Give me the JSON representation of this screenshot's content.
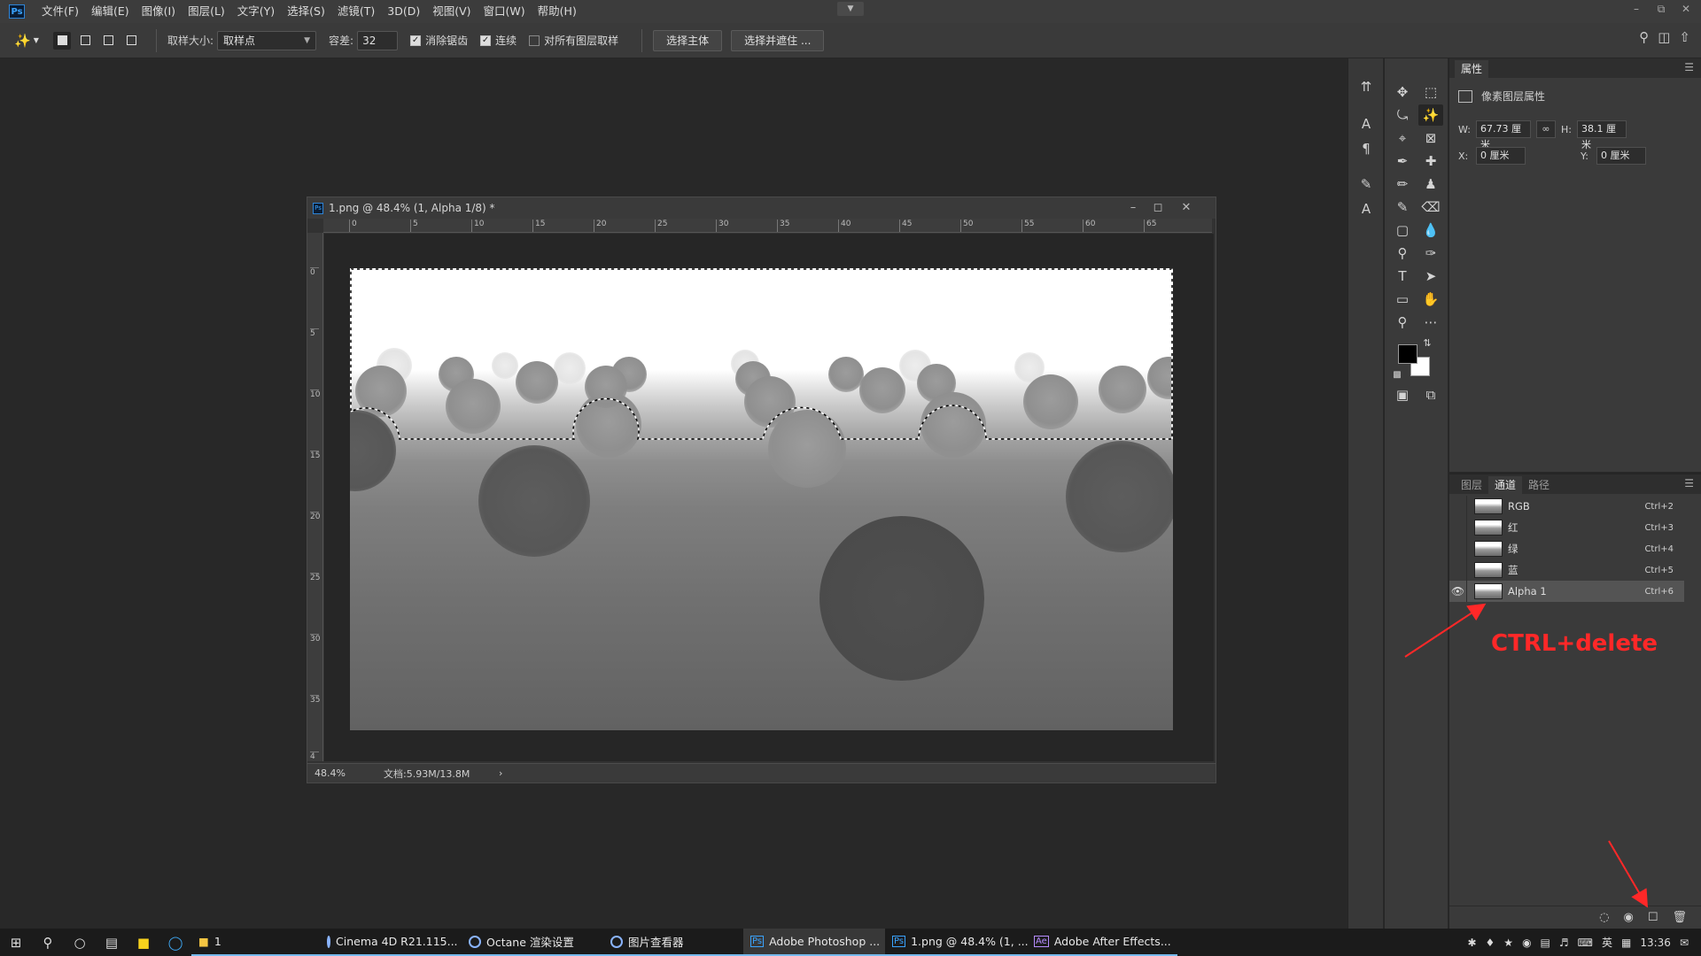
{
  "menubar": {
    "logo": "Ps",
    "items": [
      "文件(F)",
      "编辑(E)",
      "图像(I)",
      "图层(L)",
      "文字(Y)",
      "选择(S)",
      "滤镜(T)",
      "3D(D)",
      "视图(V)",
      "窗口(W)",
      "帮助(H)"
    ]
  },
  "options": {
    "sample_size_label": "取样大小:",
    "sample_size_value": "取样点",
    "tolerance_label": "容差:",
    "tolerance_value": "32",
    "antialias_label": "消除锯齿",
    "contiguous_label": "连续",
    "sample_all_label": "对所有图层取样",
    "select_subject": "选择主体",
    "select_mask": "选择并遮住 ..."
  },
  "document": {
    "title": "1.png @ 48.4% (1, Alpha 1/8) *",
    "zoom": "48.4%",
    "doc_info": "文档:5.93M/13.8M",
    "status_arrow": "›",
    "ruler_top": [
      "0",
      "5",
      "10",
      "15",
      "20",
      "25",
      "30",
      "35",
      "40",
      "45",
      "50",
      "55",
      "60",
      "65"
    ],
    "ruler_left": [
      "0",
      "5",
      "10",
      "15",
      "20",
      "25",
      "30",
      "35",
      "4"
    ]
  },
  "properties": {
    "tab": "属性",
    "section": "像素图层属性",
    "w_label": "W:",
    "w_value": "67.73 厘米",
    "h_label": "H:",
    "h_value": "38.1 厘米",
    "x_label": "X:",
    "x_value": "0 厘米",
    "y_label": "Y:",
    "y_value": "0 厘米"
  },
  "channels": {
    "tabs": [
      "图层",
      "通道",
      "路径"
    ],
    "active_tab": "通道",
    "rows": [
      {
        "name": "RGB",
        "shortcut": "Ctrl+2",
        "visible": false
      },
      {
        "name": "红",
        "shortcut": "Ctrl+3",
        "visible": false
      },
      {
        "name": "绿",
        "shortcut": "Ctrl+4",
        "visible": false
      },
      {
        "name": "蓝",
        "shortcut": "Ctrl+5",
        "visible": false
      },
      {
        "name": "Alpha 1",
        "shortcut": "Ctrl+6",
        "visible": true,
        "selected": true
      }
    ]
  },
  "annotation": {
    "text": "CTRL+delete",
    "color": "#ff2828"
  },
  "taskbar": {
    "apps": [
      {
        "label": "1",
        "icon": "folder-icon"
      },
      {
        "label": "Cinema 4D R21.115...",
        "icon": "c4d-icon"
      },
      {
        "label": "Octane 渲染设置",
        "icon": "octane-icon"
      },
      {
        "label": "图片查看器",
        "icon": "viewer-icon"
      },
      {
        "label": "Adobe Photoshop ...",
        "icon": "photoshop-icon"
      },
      {
        "label": "1.png @ 48.4% (1, ...",
        "icon": "photoshop-icon"
      },
      {
        "label": "Adobe After Effects...",
        "icon": "aftereffects-icon"
      }
    ],
    "ime": "英",
    "time": "13:36"
  },
  "colors": {
    "foreground": "#000000",
    "background": "#ffffff",
    "accent": "#2e84d6"
  }
}
